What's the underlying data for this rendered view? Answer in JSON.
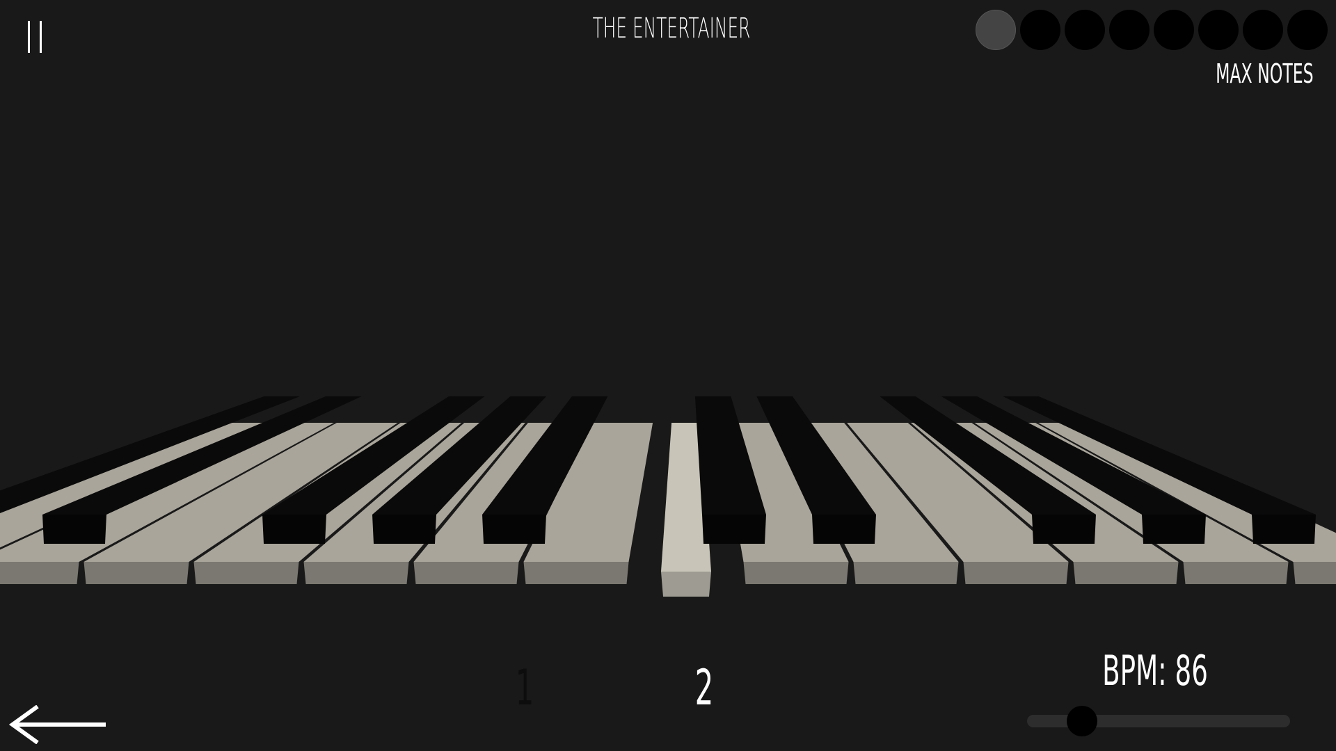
{
  "song_title": "THE ENTERTAINER",
  "max_notes_label": "MAX NOTES",
  "note_slots": {
    "total": 8,
    "active_index": 0
  },
  "voices": [
    "1",
    "2"
  ],
  "active_voice": "2",
  "bpm_label": "BPM: 86",
  "bpm_slider_fraction": 0.21,
  "colors": {
    "background": "#191919",
    "white_key": "#a9a59b",
    "pressed_key": "#c8c5b8",
    "black_key": "#0a0a0a",
    "dot_active": "#444444",
    "dot_inactive": "#000000"
  },
  "icons": {
    "pause": "pause-icon",
    "back": "arrow-left-icon"
  }
}
